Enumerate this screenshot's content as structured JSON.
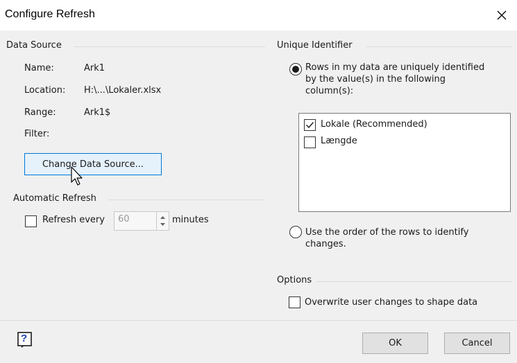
{
  "window": {
    "title": "Configure Refresh"
  },
  "data_source": {
    "group_label": "Data Source",
    "name_label": "Name:",
    "name_value": "Ark1",
    "location_label": "Location:",
    "location_value": "H:\\...\\Lokaler.xlsx",
    "range_label": "Range:",
    "range_value": "Ark1$",
    "filter_label": "Filter:",
    "change_button": "Change Data Source..."
  },
  "automatic_refresh": {
    "group_label": "Automatic Refresh",
    "refresh_label": "Refresh every",
    "interval_value": "60",
    "unit_label": "minutes",
    "checked": false
  },
  "unique_identifier": {
    "group_label": "Unique Identifier",
    "option_columns": {
      "line1": "Rows in my data are uniquely identified",
      "line2": "by the value(s) in the following",
      "line3": "column(s):",
      "selected": true
    },
    "columns": [
      {
        "label": "Lokale (Recommended)",
        "checked": true
      },
      {
        "label": "Længde",
        "checked": false
      }
    ],
    "option_order": {
      "line1": "Use the order of the rows to identify",
      "line2": "changes.",
      "selected": false
    }
  },
  "options": {
    "group_label": "Options",
    "overwrite_label": "Overwrite user changes to shape data",
    "overwrite_checked": false
  },
  "footer": {
    "help_glyph": "?",
    "ok_label": "OK",
    "cancel_label": "Cancel"
  }
}
